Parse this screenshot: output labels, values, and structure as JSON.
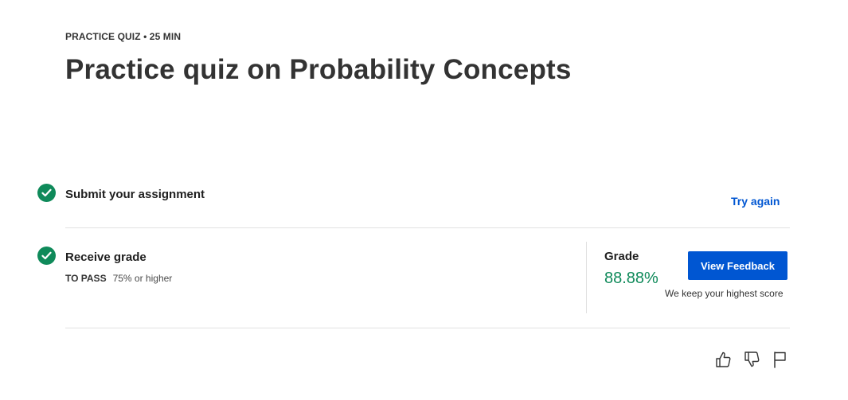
{
  "header": {
    "eyebrow": "PRACTICE QUIZ • 25 MIN",
    "title": "Practice quiz on Probability Concepts"
  },
  "steps": {
    "submit": {
      "label": "Submit your assignment",
      "action_label": "Try again"
    },
    "receive": {
      "label": "Receive grade",
      "pass_key": "TO PASS",
      "pass_value": "75% or higher"
    }
  },
  "grade": {
    "label": "Grade",
    "value": "88.88%",
    "button_label": "View Feedback",
    "note": "We keep your highest score"
  },
  "feedback_icons": [
    "thumbs-up-icon",
    "thumbs-down-icon",
    "flag-icon"
  ],
  "colors": {
    "success": "#0f8a5a",
    "primary": "#0056d2",
    "divider": "#e1e1e1"
  }
}
